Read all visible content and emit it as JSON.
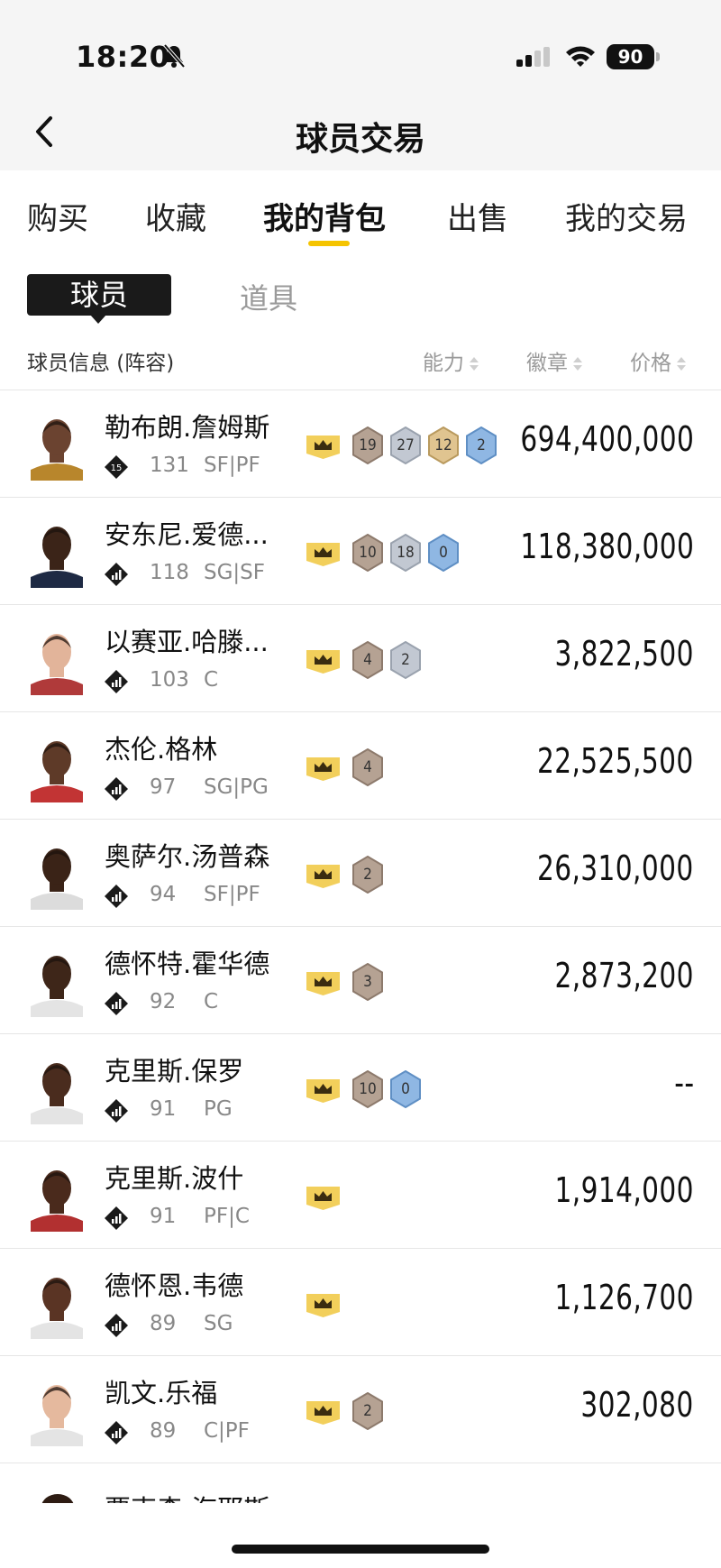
{
  "status_bar": {
    "time": "18:20",
    "battery": "90"
  },
  "nav": {
    "title": "球员交易"
  },
  "tabs": [
    {
      "label": "购买",
      "active": false
    },
    {
      "label": "收藏",
      "active": false
    },
    {
      "label": "我的背包",
      "active": true
    },
    {
      "label": "出售",
      "active": false
    },
    {
      "label": "我的交易",
      "active": false
    }
  ],
  "segments": {
    "active": "球员",
    "other": "道具"
  },
  "columns": {
    "info": "球员信息 (阵容)",
    "ability": "能力",
    "badges": "徽章",
    "price": "价格"
  },
  "players": [
    {
      "name": "勒布朗.詹姆斯",
      "tier": "15",
      "rating": "131",
      "position": "SF|PF",
      "badges": [
        {
          "value": "19",
          "kind": "bronze"
        },
        {
          "value": "27",
          "kind": "silver"
        },
        {
          "value": "12",
          "kind": "gold"
        },
        {
          "value": "2",
          "kind": "blue"
        }
      ],
      "price": "694,400,000",
      "skin": "#6b4330",
      "jersey": "#b8862c"
    },
    {
      "name": "安东尼.爱德...",
      "tier": "",
      "rating": "118",
      "position": "SG|SF",
      "badges": [
        {
          "value": "10",
          "kind": "bronze"
        },
        {
          "value": "18",
          "kind": "silver"
        },
        {
          "value": "0",
          "kind": "blue"
        }
      ],
      "price": "118,380,000",
      "skin": "#3b2418",
      "jersey": "#1e2a44"
    },
    {
      "name": "以赛亚.哈滕...",
      "tier": "",
      "rating": "103",
      "position": "C",
      "badges": [
        {
          "value": "4",
          "kind": "bronze"
        },
        {
          "value": "2",
          "kind": "silver"
        }
      ],
      "price": "3,822,500",
      "skin": "#e2b49a",
      "jersey": "#b03a3a"
    },
    {
      "name": "杰伦.格林",
      "tier": "",
      "rating": "97",
      "position": "SG|PG",
      "badges": [
        {
          "value": "4",
          "kind": "bronze"
        }
      ],
      "price": "22,525,500",
      "skin": "#5e3a28",
      "jersey": "#c23434"
    },
    {
      "name": "奥萨尔.汤普森",
      "tier": "",
      "rating": "94",
      "position": "SF|PF",
      "badges": [
        {
          "value": "2",
          "kind": "bronze"
        }
      ],
      "price": "26,310,000",
      "skin": "#3a2317",
      "jersey": "#dcdcdc"
    },
    {
      "name": "德怀特.霍华德",
      "tier": "",
      "rating": "92",
      "position": "C",
      "badges": [
        {
          "value": "3",
          "kind": "bronze"
        }
      ],
      "price": "2,873,200",
      "skin": "#3e2619",
      "jersey": "#e4e4e4"
    },
    {
      "name": "克里斯.保罗",
      "tier": "",
      "rating": "91",
      "position": "PG",
      "badges": [
        {
          "value": "10",
          "kind": "bronze"
        },
        {
          "value": "0",
          "kind": "blue"
        }
      ],
      "price": "--",
      "skin": "#4a2c1e",
      "jersey": "#e4e4e4"
    },
    {
      "name": "克里斯.波什",
      "tier": "",
      "rating": "91",
      "position": "PF|C",
      "badges": [],
      "price": "1,914,000",
      "skin": "#4a2a1c",
      "jersey": "#b23030"
    },
    {
      "name": "德怀恩.韦德",
      "tier": "",
      "rating": "89",
      "position": "SG",
      "badges": [],
      "price": "1,126,700",
      "skin": "#5a3424",
      "jersey": "#e4e4e4"
    },
    {
      "name": "凯文.乐福",
      "tier": "",
      "rating": "89",
      "position": "C|PF",
      "badges": [
        {
          "value": "2",
          "kind": "bronze"
        }
      ],
      "price": "302,080",
      "skin": "#e5b99e",
      "jersey": "#e4e4e4"
    }
  ],
  "partial_row": {
    "name": "贾克森.海耶斯"
  },
  "colors": {
    "accent": "#f5c400",
    "crown": "#f2cf5b",
    "bronze": "#b5a293",
    "silver": "#c2c8d2",
    "gold": "#e0c490",
    "blue": "#8fb7e3"
  }
}
